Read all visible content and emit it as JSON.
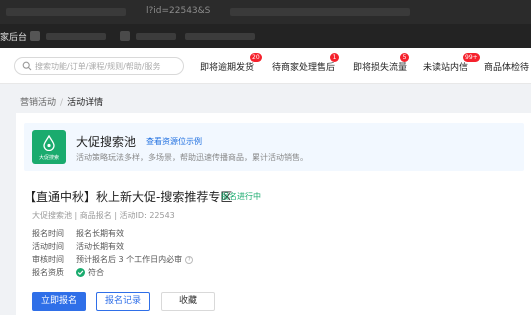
{
  "browser": {
    "url_fragment": "l?id=22543&S",
    "bookmark_label": "家后台"
  },
  "header": {
    "search_placeholder": "搜索功能/订单/课程/规则/帮助/服务",
    "nav": [
      {
        "label": "即将逾期发货",
        "badge": "20"
      },
      {
        "label": "待商家处理售后",
        "badge": "1"
      },
      {
        "label": "即将损失流量",
        "badge": "5"
      },
      {
        "label": "未读站内信",
        "badge": "99+"
      },
      {
        "label": "商品体检待",
        "badge": ""
      }
    ]
  },
  "breadcrumb": {
    "parent": "营销活动",
    "separator": "/",
    "current": "活动详情"
  },
  "pool": {
    "logo_text": "大促搜索",
    "title": "大促搜索池",
    "link": "查看资源位示例",
    "description": "活动策略玩法多样，多场景，帮助迅速传播商品，累计活动销售。"
  },
  "activity": {
    "title": "【直通中秋】秋上新大促-搜索推荐专区",
    "status": "报名进行中",
    "meta": "大促搜索池 | 商品报名 | 活动ID: 22543",
    "details": [
      {
        "label": "报名时间",
        "value": "报名长期有效"
      },
      {
        "label": "活动时间",
        "value": "活动长期有效"
      },
      {
        "label": "审核时间",
        "value": "预计报名后 3 个工作日内必审"
      },
      {
        "label": "报名资质",
        "value": "符合"
      }
    ]
  },
  "buttons": {
    "register": "立即报名",
    "records": "报名记录",
    "favorite": "收藏"
  },
  "colors": {
    "primary": "#2f6fe8",
    "success": "#1aab6e",
    "badge": "#f5222d"
  }
}
